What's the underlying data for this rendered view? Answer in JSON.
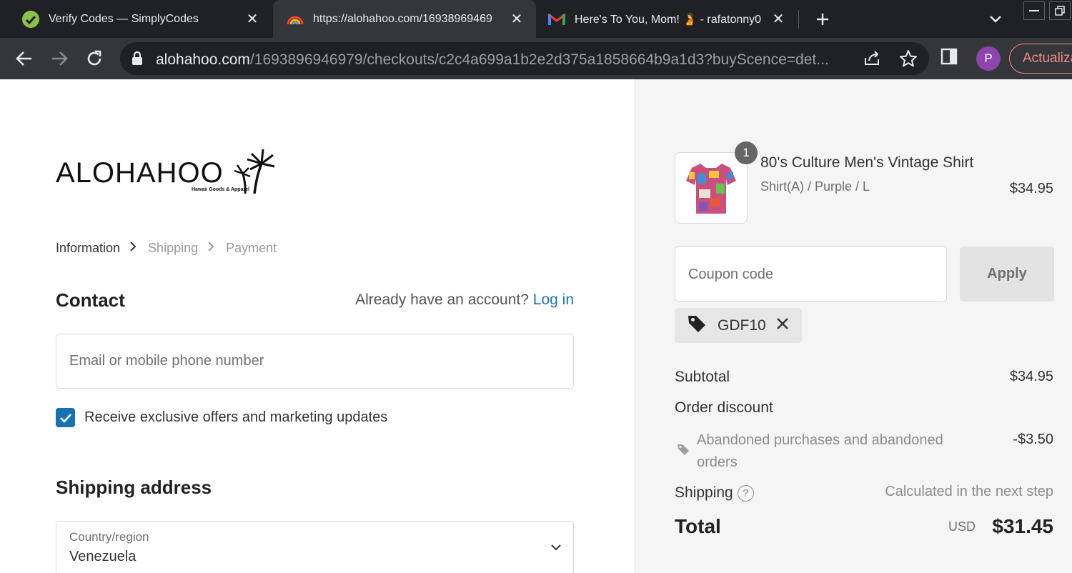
{
  "browser": {
    "tabs": [
      {
        "title": "Verify Codes — SimplyCodes",
        "favicon": "simplycodes-icon",
        "active": false
      },
      {
        "title": "https://alohahoo.com/16938969469",
        "favicon": "rainbow-icon",
        "active": true
      },
      {
        "title": "Here's To You, Mom! 🫄 - rafatonny0",
        "favicon": "gmail-icon",
        "active": false
      }
    ],
    "url_host": "alohahoo.com",
    "url_path": "/1693896946979/checkouts/c2c4a699a1b2e2d375a1858664b9a1d3?buyScence=det...",
    "profile_initial": "P",
    "update_label": "Actualiza"
  },
  "store": {
    "logo_text": "ALOHAHOO",
    "logo_tagline": "Hawaii Goods & Apparel"
  },
  "breadcrumb": {
    "current": "Information",
    "step2": "Shipping",
    "step3": "Payment"
  },
  "contact": {
    "heading": "Contact",
    "account_prompt": "Already have an account?",
    "login_label": "Log in",
    "email_placeholder": "Email or mobile phone number",
    "marketing_label": "Receive exclusive offers and marketing updates",
    "marketing_checked": true
  },
  "shipping": {
    "heading": "Shipping address",
    "country_label": "Country/region",
    "country_value": "Venezuela"
  },
  "summary": {
    "quantity": "1",
    "product_name": "80's Culture Men's Vintage Shirt",
    "product_variant": "Shirt(A) / Purple / L",
    "product_price": "$34.95",
    "coupon_placeholder": "Coupon code",
    "apply_label": "Apply",
    "applied_code": "GDF10",
    "subtotal_label": "Subtotal",
    "subtotal_value": "$34.95",
    "discount_label": "Order discount",
    "discount_desc": "Abandoned purchases and abandoned orders",
    "discount_value": "-$3.50",
    "shipping_label": "Shipping",
    "shipping_value": "Calculated in the next step",
    "total_label": "Total",
    "currency": "USD",
    "total_value": "$31.45"
  }
}
